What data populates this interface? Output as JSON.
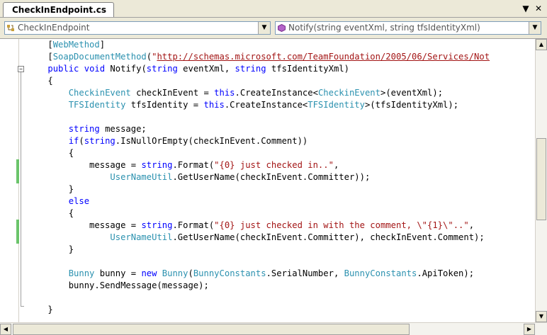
{
  "tab": {
    "title": "CheckInEndpoint.cs",
    "dropdown_glyph": "▼",
    "close_glyph": "✕"
  },
  "nav": {
    "class_combo": "CheckInEndpoint",
    "method_combo": "Notify(string eventXml, string tfsIdentityXml)",
    "arrow": "▼"
  },
  "scroll": {
    "up": "▲",
    "down": "▼",
    "left": "◀",
    "right": "▶"
  },
  "code_lines": [
    [
      [
        "pl",
        "    ["
      ],
      [
        "ty",
        "WebMethod"
      ],
      [
        "pl",
        "]"
      ]
    ],
    [
      [
        "pl",
        "    ["
      ],
      [
        "ty",
        "SoapDocumentMethod"
      ],
      [
        "pl",
        "("
      ],
      [
        "str",
        "\""
      ],
      [
        "url",
        "http://schemas.microsoft.com/TeamFoundation/2005/06/Services/Not"
      ]
    ],
    [
      [
        "pl",
        "    "
      ],
      [
        "kw",
        "public"
      ],
      [
        "pl",
        " "
      ],
      [
        "kw",
        "void"
      ],
      [
        "pl",
        " Notify("
      ],
      [
        "kw",
        "string"
      ],
      [
        "pl",
        " eventXml, "
      ],
      [
        "kw",
        "string"
      ],
      [
        "pl",
        " tfsIdentityXml)"
      ]
    ],
    [
      [
        "pl",
        "    {"
      ]
    ],
    [
      [
        "pl",
        "        "
      ],
      [
        "ty",
        "CheckinEvent"
      ],
      [
        "pl",
        " checkInEvent = "
      ],
      [
        "kw",
        "this"
      ],
      [
        "pl",
        ".CreateInstance<"
      ],
      [
        "ty",
        "CheckinEvent"
      ],
      [
        "pl",
        ">(eventXml);"
      ]
    ],
    [
      [
        "pl",
        "        "
      ],
      [
        "ty",
        "TFSIdentity"
      ],
      [
        "pl",
        " tfsIdentity = "
      ],
      [
        "kw",
        "this"
      ],
      [
        "pl",
        ".CreateInstance<"
      ],
      [
        "ty",
        "TFSIdentity"
      ],
      [
        "pl",
        ">(tfsIdentityXml);"
      ]
    ],
    [
      [
        "pl",
        ""
      ]
    ],
    [
      [
        "pl",
        "        "
      ],
      [
        "kw",
        "string"
      ],
      [
        "pl",
        " message;"
      ]
    ],
    [
      [
        "pl",
        "        "
      ],
      [
        "kw",
        "if"
      ],
      [
        "pl",
        "("
      ],
      [
        "kw",
        "string"
      ],
      [
        "pl",
        ".IsNullOrEmpty(checkInEvent.Comment))"
      ]
    ],
    [
      [
        "pl",
        "        {"
      ]
    ],
    [
      [
        "pl",
        "            message = "
      ],
      [
        "kw",
        "string"
      ],
      [
        "pl",
        ".Format("
      ],
      [
        "str",
        "\"{0} just checked in..\""
      ],
      [
        "pl",
        ","
      ]
    ],
    [
      [
        "pl",
        "                "
      ],
      [
        "ty",
        "UserNameUtil"
      ],
      [
        "pl",
        ".GetUserName(checkInEvent.Committer));"
      ]
    ],
    [
      [
        "pl",
        "        }"
      ]
    ],
    [
      [
        "pl",
        "        "
      ],
      [
        "kw",
        "else"
      ]
    ],
    [
      [
        "pl",
        "        {"
      ]
    ],
    [
      [
        "pl",
        "            message = "
      ],
      [
        "kw",
        "string"
      ],
      [
        "pl",
        ".Format("
      ],
      [
        "str",
        "\"{0} just checked in with the comment, \\\"{1}\\\"..\""
      ],
      [
        "pl",
        ","
      ]
    ],
    [
      [
        "pl",
        "                "
      ],
      [
        "ty",
        "UserNameUtil"
      ],
      [
        "pl",
        ".GetUserName(checkInEvent.Committer), checkInEvent.Comment);"
      ]
    ],
    [
      [
        "pl",
        "        }"
      ]
    ],
    [
      [
        "pl",
        ""
      ]
    ],
    [
      [
        "pl",
        "        "
      ],
      [
        "ty",
        "Bunny"
      ],
      [
        "pl",
        " bunny = "
      ],
      [
        "kw",
        "new"
      ],
      [
        "pl",
        " "
      ],
      [
        "ty",
        "Bunny"
      ],
      [
        "pl",
        "("
      ],
      [
        "ty",
        "BunnyConstants"
      ],
      [
        "pl",
        ".SerialNumber, "
      ],
      [
        "ty",
        "BunnyConstants"
      ],
      [
        "pl",
        ".ApiToken);"
      ]
    ],
    [
      [
        "pl",
        "        bunny.SendMessage(message);"
      ]
    ],
    [
      [
        "pl",
        ""
      ]
    ],
    [
      [
        "pl",
        "    }"
      ]
    ]
  ],
  "colors": {
    "keyword": "#0000ff",
    "type": "#2b91af",
    "string": "#a31515",
    "plain": "#000000",
    "change_marker": "#6bc46b"
  }
}
